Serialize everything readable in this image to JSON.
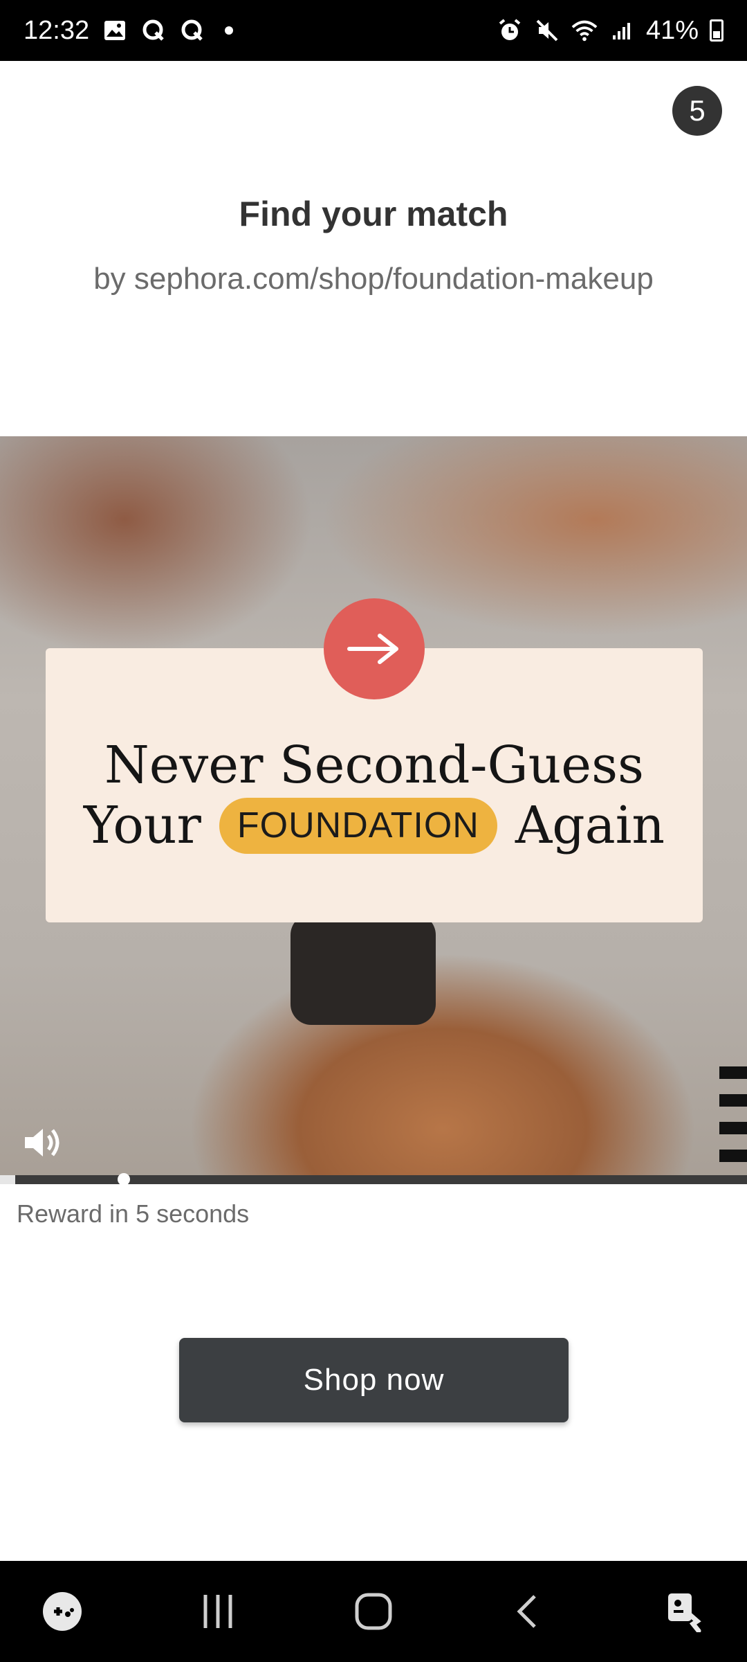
{
  "status_bar": {
    "time": "12:32",
    "battery": "41%",
    "icons_left": [
      "gallery-icon",
      "q-app-icon",
      "q-app-icon",
      "notification-dot"
    ],
    "icons_right": [
      "alarm-icon",
      "mute-icon",
      "wifi-icon",
      "signal-icon",
      "battery-icon"
    ]
  },
  "ad": {
    "countdown": "5",
    "title": "Find your match",
    "source": "by sephora.com/shop/foundation-makeup",
    "video": {
      "headline_line1": "Never Second-Guess",
      "headline_line2_left": "Your",
      "headline_pill": "FOUNDATION",
      "headline_line2_right": "Again",
      "accent_color": "#e05e59",
      "pill_color": "#eeb340",
      "progress": 0.02
    },
    "reward_text": "Reward in 5 seconds",
    "cta_label": "Shop now"
  },
  "nav_bar": {
    "buttons": [
      "game-launcher-icon",
      "recent-apps-icon",
      "home-icon",
      "back-icon",
      "accessibility-icon"
    ]
  }
}
